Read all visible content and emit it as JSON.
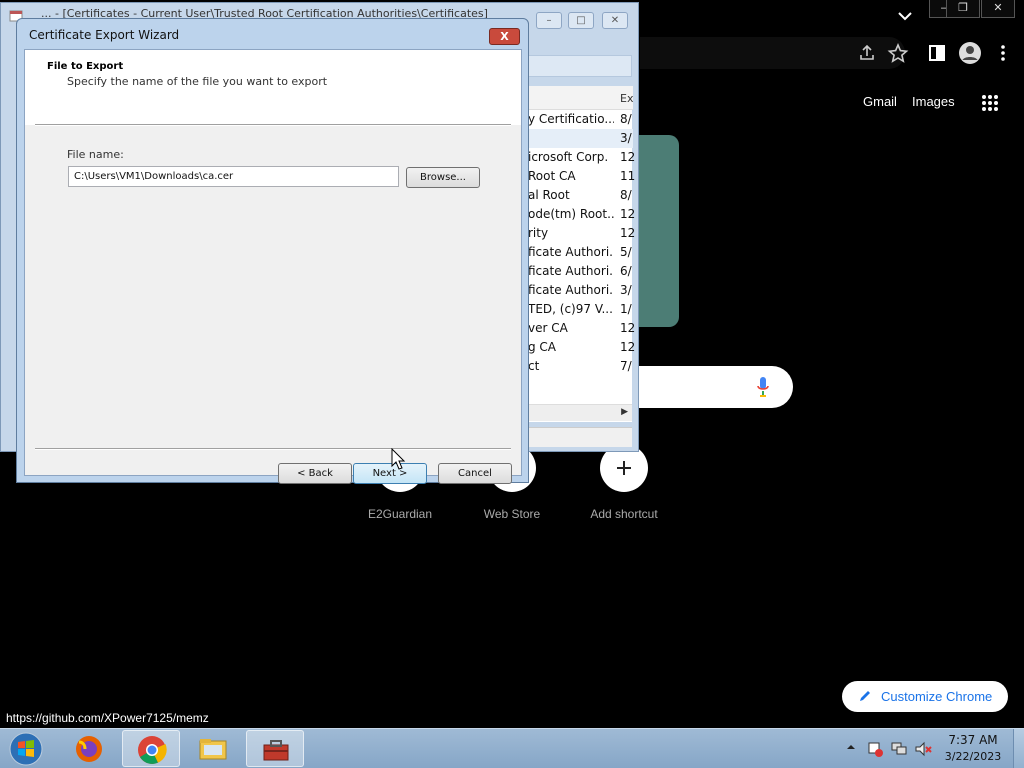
{
  "chrome": {
    "gmail": "Gmail",
    "images": "Images",
    "shortcuts": [
      {
        "label": "E2Guardian"
      },
      {
        "label": "Web Store"
      },
      {
        "label": "Add shortcut"
      }
    ],
    "customize": "Customize Chrome",
    "status_url": "https://github.com/XPower7125/memz"
  },
  "cert_window": {
    "title": "... - [Certificates - Current User\\Trusted Root Certification Authorities\\Certificates]",
    "column_expires": "Ex",
    "rows": [
      {
        "name": "y Certificatio...",
        "expires": "8/"
      },
      {
        "name": "",
        "expires": "3/"
      },
      {
        "name": "icrosoft Corp.",
        "expires": "12"
      },
      {
        "name": "Root CA",
        "expires": "11"
      },
      {
        "name": "al Root",
        "expires": "8/"
      },
      {
        "name": "ode(tm) Root...",
        "expires": "12"
      },
      {
        "name": "rity",
        "expires": "12"
      },
      {
        "name": "ficate Authori...",
        "expires": "5/"
      },
      {
        "name": "ficate Authori...",
        "expires": "6/"
      },
      {
        "name": "ficate Authori...",
        "expires": "3/"
      },
      {
        "name": "TED, (c)97 V...",
        "expires": "1/"
      },
      {
        "name": "ver CA",
        "expires": "12"
      },
      {
        "name": "g CA",
        "expires": "12"
      },
      {
        "name": "ct",
        "expires": "7/"
      }
    ]
  },
  "wizard": {
    "title": "Certificate Export Wizard",
    "close": "X",
    "heading": "File to Export",
    "subheading": "Specify the name of the file you want to export",
    "file_label": "File name:",
    "file_value": "C:\\Users\\VM1\\Downloads\\ca.cer",
    "browse": "Browse...",
    "back": "< Back",
    "next": "Next >",
    "cancel": "Cancel"
  },
  "taskbar": {
    "time": "7:37 AM",
    "date": "3/22/2023"
  },
  "colors": {
    "chrome_bg": "#000000",
    "card_green": "#4c7d75",
    "customize_blue": "#1a73e8",
    "wizard_frame": "#bcd3ec",
    "taskbar": "#9fbad5"
  }
}
